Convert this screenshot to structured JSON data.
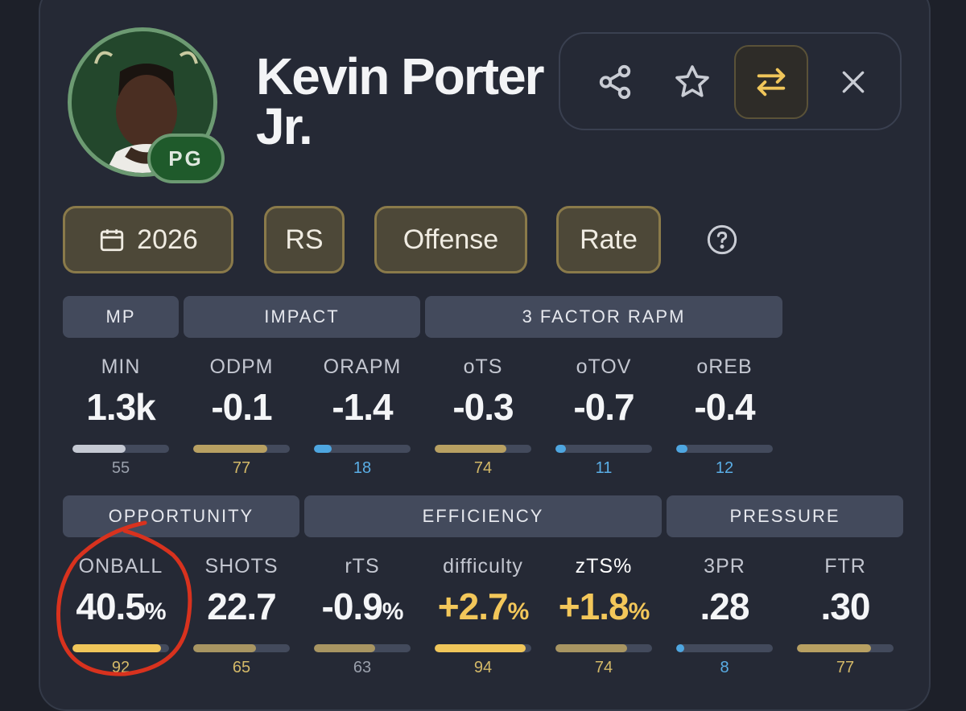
{
  "player": {
    "name": "Kevin Porter Jr.",
    "position": "PG"
  },
  "actions": [
    {
      "icon": "share-icon",
      "active": false
    },
    {
      "icon": "star-icon",
      "active": false
    },
    {
      "icon": "swap-icon",
      "active": true
    },
    {
      "icon": "close-icon",
      "active": false
    }
  ],
  "filters": {
    "season": "2026",
    "season_type": "RS",
    "side": "Offense",
    "mode": "Rate"
  },
  "row1": {
    "sections": [
      "MP",
      "IMPACT",
      "3 FACTOR RAPM"
    ],
    "stats": [
      {
        "label": "MIN",
        "value": "1.3k",
        "pct_sign": "",
        "percentile": 55,
        "bar_color": "#c5c9d3",
        "pct_color": "#9aa0ac",
        "gold": false
      },
      {
        "label": "ODPM",
        "value": "-0.1",
        "pct_sign": "",
        "percentile": 77,
        "bar_color": "#b8a062",
        "pct_color": "#d4b968",
        "gold": false
      },
      {
        "label": "ORAPM",
        "value": "-1.4",
        "pct_sign": "",
        "percentile": 18,
        "bar_color": "#4ea6e0",
        "pct_color": "#5aaee6",
        "gold": false
      },
      {
        "label": "oTS",
        "value": "-0.3",
        "pct_sign": "",
        "percentile": 74,
        "bar_color": "#b8a062",
        "pct_color": "#d4b968",
        "gold": false
      },
      {
        "label": "oTOV",
        "value": "-0.7",
        "pct_sign": "",
        "percentile": 11,
        "bar_color": "#4ea6e0",
        "pct_color": "#5aaee6",
        "gold": false
      },
      {
        "label": "oREB",
        "value": "-0.4",
        "pct_sign": "",
        "percentile": 12,
        "bar_color": "#4ea6e0",
        "pct_color": "#5aaee6",
        "gold": false
      }
    ]
  },
  "row2": {
    "sections": [
      "OPPORTUNITY",
      "EFFICIENCY",
      "PRESSURE"
    ],
    "stats": [
      {
        "label": "ONBALL",
        "value": "40.5",
        "pct_sign": "%",
        "percentile": 92,
        "bar_color": "#f0c65a",
        "pct_color": "#d4b968",
        "gold": false
      },
      {
        "label": "SHOTS",
        "value": "22.7",
        "pct_sign": "",
        "percentile": 65,
        "bar_color": "#a89562",
        "pct_color": "#d4b968",
        "gold": false
      },
      {
        "label": "rTS",
        "value": "-0.9",
        "pct_sign": "%",
        "percentile": 63,
        "bar_color": "#a89562",
        "pct_color": "#9aa0ac",
        "gold": false
      },
      {
        "label": "difficulty",
        "value": "+2.7",
        "pct_sign": "%",
        "percentile": 94,
        "bar_color": "#f0c65a",
        "pct_color": "#d4b968",
        "gold": true
      },
      {
        "label": "zTS%",
        "value": "+1.8",
        "pct_sign": "%",
        "percentile": 74,
        "bar_color": "#a89562",
        "pct_color": "#d4b968",
        "gold": true
      },
      {
        "label": "3PR",
        "value": ".28",
        "pct_sign": "",
        "percentile": 8,
        "bar_color": "#4ea6e0",
        "pct_color": "#5aaee6",
        "gold": false
      },
      {
        "label": "FTR",
        "value": ".30",
        "pct_sign": "",
        "percentile": 77,
        "bar_color": "#b8a062",
        "pct_color": "#d4b968",
        "gold": false
      }
    ]
  },
  "colors": {
    "background": "#1d2029",
    "card": "#252935",
    "chip": "#4d4838",
    "chip_border": "#8a7a4a",
    "section": "#434a5c",
    "gold": "#f3c75a",
    "blue": "#4ea6e0",
    "annotation": "#d8321e"
  }
}
